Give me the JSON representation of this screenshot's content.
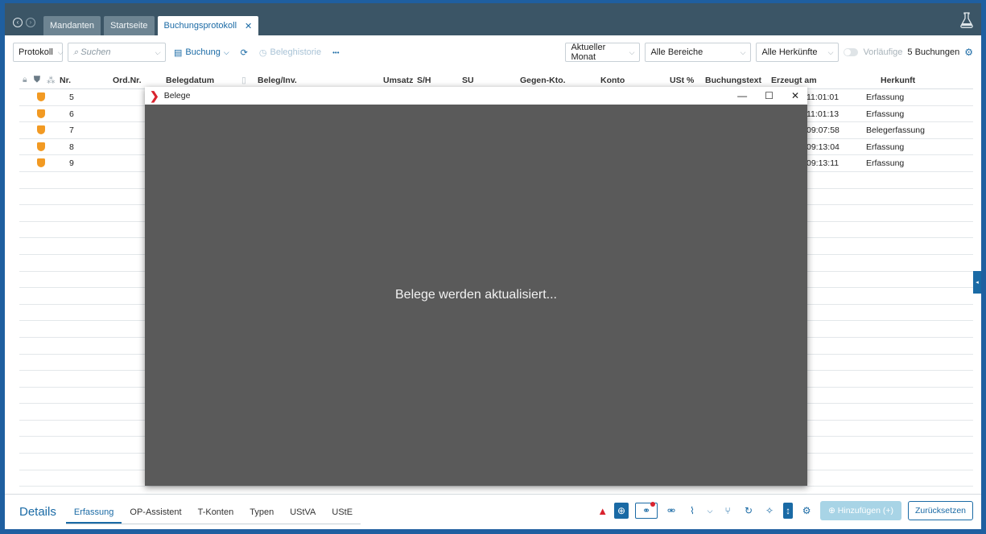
{
  "tabs": [
    {
      "label": "Mandanten"
    },
    {
      "label": "Startseite"
    },
    {
      "label": "Buchungsprotokoll"
    }
  ],
  "toolbar": {
    "view_select": "Protokoll",
    "search_placeholder": "Suchen",
    "buchung_label": "Buchung",
    "beleghistorie_label": "Beleghistorie",
    "more_label": "•••",
    "period_select": "Aktueller Monat",
    "area_select": "Alle Bereiche",
    "origin_select": "Alle Herkünfte",
    "vorlaeufige_label": "Vorläufige",
    "count_label": "5 Buchungen"
  },
  "table": {
    "headers": {
      "nr": "Nr.",
      "ordnr": "Ord.Nr.",
      "belegdatum": "Belegdatum",
      "beleg": "Beleg/Inv.",
      "umsatz": "Umsatz",
      "sh": "S/H",
      "su": "SU",
      "gegenkto": "Gegen-Kto.",
      "konto": "Konto",
      "ust": "USt %",
      "buchungstext": "Buchungstext",
      "erzeugt": "Erzeugt am",
      "herkunft": "Herkunft"
    },
    "rows": [
      {
        "nr": "5",
        "erzeugt": "11:01:01",
        "herkunft": "Erfassung"
      },
      {
        "nr": "6",
        "erzeugt": "11:01:13",
        "herkunft": "Erfassung"
      },
      {
        "nr": "7",
        "erzeugt": "09:07:58",
        "herkunft": "Belegerfassung"
      },
      {
        "nr": "8",
        "erzeugt": "09:13:04",
        "herkunft": "Erfassung"
      },
      {
        "nr": "9",
        "erzeugt": "09:13:11",
        "herkunft": "Erfassung"
      }
    ]
  },
  "modal": {
    "title": "Belege",
    "minimize": "—",
    "maximize": "☐",
    "close": "✕",
    "message": "Belege werden aktualisiert..."
  },
  "bottom": {
    "details_title": "Details",
    "tabs": [
      "Erfassung",
      "OP-Assistent",
      "T-Konten",
      "Typen",
      "UStVA",
      "UStE"
    ],
    "add_label": "Hinzufügen (+)",
    "reset_label": "Zurücksetzen"
  }
}
